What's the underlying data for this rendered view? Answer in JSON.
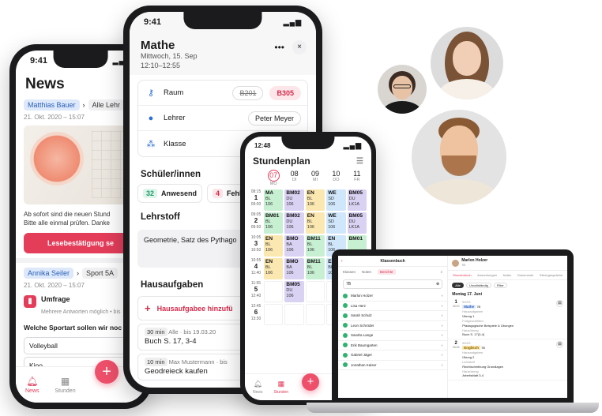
{
  "news_phone": {
    "time": "9:41",
    "title": "News",
    "post1": {
      "author": "Matthias Bauer",
      "target": "Alle Lehr",
      "date": "21. Okt. 2020 – 15:07",
      "text_line1": "Ab sofort sind die neuen Stund",
      "text_line2": "Bitte alle einmal prüfen. Danke",
      "button": "Lesebestätigung se"
    },
    "post2": {
      "author": "Annika Seiler",
      "target": "Sport 5A",
      "date": "21. Okt. 2020 – 15:07",
      "poll_title": "Umfrage",
      "poll_sub": "Mehrere Antworten möglich • bis",
      "question": "Welche Sportart sollen wir noc",
      "option1": "Volleyball",
      "option2": "Kino"
    },
    "tabs": [
      {
        "label": "News",
        "icon": "bell-icon"
      },
      {
        "label": "Stunden",
        "icon": "calendar-icon"
      }
    ],
    "fab": "+"
  },
  "detail_phone": {
    "time": "9:41",
    "subject": "Mathe",
    "date": "Mittwoch, 15. Sep",
    "time_range": "12:10–12:55",
    "more": "•••",
    "close": "×",
    "rows": {
      "raum_label": "Raum",
      "raum_old": "B201",
      "raum_new": "B305",
      "lehrer_label": "Lehrer",
      "lehrer_value": "Peter Meyer",
      "klasse_label": "Klasse"
    },
    "students_heading": "Schüler/innen",
    "present_count": "32",
    "present_label": "Anwesend",
    "absent_count": "4",
    "absent_label": "Fehle",
    "lehrstoff_heading": "Lehrstoff",
    "lehrstoff_text": "Geometrie, Satz des Pythago",
    "homework_heading": "Hausaufgaben",
    "homework_add": "Hausaufgabee hinzufü",
    "hw1": {
      "duration": "30 min",
      "meta": "Alle · bis 19.03.20",
      "text": "Buch S. 17, 3-4"
    },
    "hw2": {
      "duration": "10 min",
      "meta": "Max Mustermann · bis",
      "text": "Geodreieck kaufen"
    }
  },
  "timetable_phone": {
    "time": "12:48",
    "title": "Stundenplan",
    "days": [
      {
        "n": "07",
        "d": "MO"
      },
      {
        "n": "08",
        "d": "DI"
      },
      {
        "n": "09",
        "d": "MI"
      },
      {
        "n": "10",
        "d": "DO"
      },
      {
        "n": "11",
        "d": "FR"
      }
    ],
    "periods": [
      {
        "num": "1",
        "start": "08:15",
        "end": "09:00",
        "cells": [
          {
            "c": "green",
            "s": "MA",
            "t": "BL",
            "r": "106"
          },
          {
            "c": "purple",
            "s": "BM02",
            "t": "DU",
            "r": "106"
          },
          {
            "c": "yellow",
            "s": "EN",
            "t": "BL",
            "r": "106"
          },
          {
            "c": "blue",
            "s": "WE",
            "t": "SD",
            "r": "106"
          },
          {
            "c": "purple",
            "s": "BM05",
            "t": "DU",
            "r": "LK1A"
          }
        ]
      },
      {
        "num": "2",
        "start": "09:05",
        "end": "09:50",
        "cells": [
          {
            "c": "green",
            "s": "BM01",
            "t": "BL",
            "r": "106"
          },
          {
            "c": "purple",
            "s": "BM02",
            "t": "DU",
            "r": "106"
          },
          {
            "c": "yellow",
            "s": "EN",
            "t": "BL",
            "r": "106"
          },
          {
            "c": "blue",
            "s": "WE",
            "t": "SD",
            "r": "106"
          },
          {
            "c": "purple",
            "s": "BM05",
            "t": "DU",
            "r": "LK1A"
          }
        ]
      },
      {
        "num": "3",
        "start": "10:05",
        "end": "10:50",
        "cells": [
          {
            "c": "yellow",
            "s": "EN",
            "t": "BL",
            "r": "106"
          },
          {
            "c": "purple",
            "s": "BMO",
            "t": "BA",
            "r": "106"
          },
          {
            "c": "green",
            "s": "BM11",
            "t": "BL",
            "r": "106"
          },
          {
            "c": "blue",
            "s": "EN",
            "t": "BL",
            "r": "106"
          },
          {
            "c": "green",
            "s": "BM01",
            "t": "",
            "r": ""
          }
        ]
      },
      {
        "num": "4",
        "start": "10:55",
        "end": "11:40",
        "cells": [
          {
            "c": "yellow",
            "s": "EN",
            "t": "BL",
            "r": "106"
          },
          {
            "c": "purple",
            "s": "BMO",
            "t": "BA",
            "r": "106"
          },
          {
            "c": "green",
            "s": "BM11",
            "t": "BL",
            "r": "106"
          },
          {
            "c": "blue",
            "s": "EN",
            "t": "BL",
            "r": "106"
          },
          {
            "c": "empty",
            "s": "",
            "t": "",
            "r": ""
          }
        ]
      },
      {
        "num": "5",
        "start": "11:55",
        "end": "12:40",
        "cells": [
          {
            "c": "empty",
            "s": "",
            "t": "",
            "r": ""
          },
          {
            "c": "purple",
            "s": "BM05",
            "t": "DU",
            "r": "106"
          },
          {
            "c": "empty",
            "s": "",
            "t": "",
            "r": ""
          },
          {
            "c": "empty",
            "s": "",
            "t": "",
            "r": ""
          },
          {
            "c": "empty",
            "s": "",
            "t": "",
            "r": ""
          }
        ]
      },
      {
        "num": "6",
        "start": "12:45",
        "end": "13:30",
        "cells": [
          {
            "c": "empty",
            "s": "",
            "t": "",
            "r": ""
          },
          {
            "c": "empty",
            "s": "",
            "t": "",
            "r": ""
          },
          {
            "c": "empty",
            "s": "",
            "t": "",
            "r": ""
          },
          {
            "c": "empty",
            "s": "",
            "t": "",
            "r": ""
          },
          {
            "c": "empty",
            "s": "",
            "t": "",
            "r": ""
          }
        ]
      }
    ],
    "tabs": [
      {
        "label": "News"
      },
      {
        "label": "Stunden"
      }
    ],
    "fab": "+"
  },
  "laptop": {
    "left_title": "Klassenbuch",
    "back": "‹",
    "tabs": [
      "Klassen",
      "Noten",
      "Berichte"
    ],
    "search_value": "7B",
    "students": [
      "Marlon Holzer",
      "Lisa Herz",
      "Sarah Schulz",
      "Leon Schröder",
      "Sandra Lange",
      "Erik Baumgarten",
      "Gabriel Jäger",
      "Jonathan Kaiser"
    ],
    "right_name": "Marlon Holzer",
    "right_class": "7B",
    "right_tabs": [
      "Stundenbuch",
      "Anmerkungen",
      "Noten",
      "Dokumente",
      "Elterngespräche"
    ],
    "filters": [
      "Alle",
      "Unvollständig",
      "Filter"
    ],
    "day": "Montag 17. Juni",
    "entries": [
      {
        "num": "1",
        "time": "08:00",
        "class": "6VZG",
        "subject": "Mathe",
        "room": "7B",
        "l1": "Hausaufgaben",
        "v1": "Übung 1",
        "l2": "Fortgeschritten",
        "v2": "Pfadagogische Beispiele & Übungen",
        "l3": "Hausübung",
        "v3": "Buch S. 17(3-4)"
      },
      {
        "num": "2",
        "time": "08:55",
        "class": "6VZG",
        "subject": "Englisch",
        "room": "7B",
        "l1": "Hausaufgaben",
        "v1": "Übung 2",
        "l2": "Lehrstoff",
        "v2": "Rechtschreibung Grundlagen",
        "l3": "Hausübung",
        "v3": "Arbeitsblatt 3-4"
      }
    ]
  }
}
